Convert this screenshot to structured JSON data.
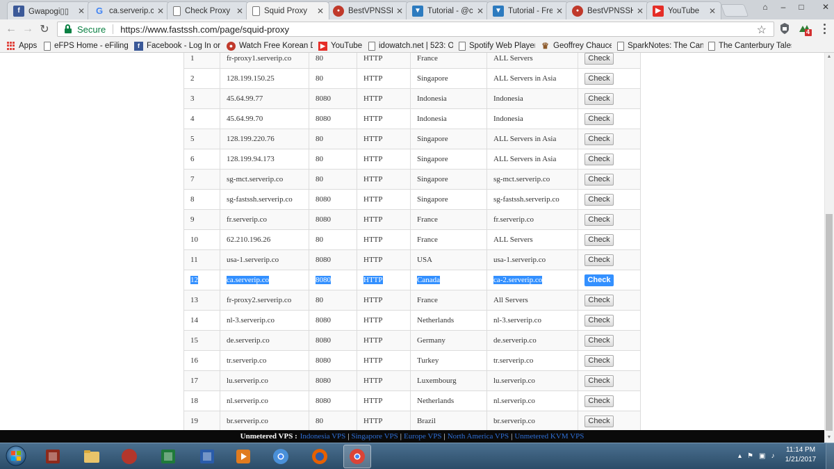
{
  "browser": {
    "tabs": [
      {
        "title": "Gwapogi▯▯",
        "favicon": "facebook-icon",
        "color": "#3b5998",
        "glyph": "f"
      },
      {
        "title": "ca.serverip.cc",
        "favicon": "google-icon",
        "color": "#4285f4",
        "glyph": "G"
      },
      {
        "title": "Check Proxy",
        "favicon": "page-icon",
        "color": "#ffffff",
        "glyph": ""
      },
      {
        "title": "Squid Proxy",
        "favicon": "page-icon",
        "color": "#ffffff",
        "glyph": ""
      },
      {
        "title": "BestVPNSSH",
        "favicon": "bestvpn-icon",
        "color": "#c0392b",
        "glyph": "●"
      },
      {
        "title": "Tutorial - @c",
        "favicon": "tutorial-icon",
        "color": "#2d7bbf",
        "glyph": "▼"
      },
      {
        "title": "Tutorial - Fre",
        "favicon": "tutorial-icon",
        "color": "#2d7bbf",
        "glyph": "▼"
      },
      {
        "title": "BestVPNSSH",
        "favicon": "bestvpn-icon",
        "color": "#c0392b",
        "glyph": "●"
      },
      {
        "title": "YouTube",
        "favicon": "youtube-icon",
        "color": "#e52d27",
        "glyph": "▶"
      }
    ],
    "active_tab": 3,
    "window_controls": {
      "user": "⌂",
      "minimize": "–",
      "maximize": "□",
      "close": "✕"
    },
    "nav": {
      "back": "←",
      "forward": "→",
      "reload": "↻"
    },
    "secure_label": "Secure",
    "url": "https://www.fastssh.com/page/squid-proxy",
    "extension_badge": "4"
  },
  "bookmarks": [
    {
      "label": "Apps",
      "icon": "apps-grid-icon"
    },
    {
      "label": "eFPS Home - eFiling a",
      "icon": "page-icon"
    },
    {
      "label": "Facebook - Log In or",
      "icon": "facebook-icon"
    },
    {
      "label": "Watch Free Korean Dr",
      "icon": "korean-drama-icon"
    },
    {
      "label": "YouTube",
      "icon": "youtube-icon"
    },
    {
      "label": "idowatch.net | 523: O",
      "icon": "page-icon"
    },
    {
      "label": "Spotify Web Player",
      "icon": "page-icon"
    },
    {
      "label": "Geoffrey Chaucer",
      "icon": "chaucer-icon"
    },
    {
      "label": "SparkNotes: The Cant",
      "icon": "page-icon"
    },
    {
      "label": "The Canterbury Tales",
      "icon": "page-icon"
    }
  ],
  "proxy_table": {
    "button_label": "Check",
    "selected_row": 12,
    "rows": [
      {
        "no": "1",
        "host": "fr-proxy1.serverip.co",
        "port": "80",
        "type": "HTTP",
        "country": "France",
        "server": "ALL Servers"
      },
      {
        "no": "2",
        "host": "128.199.150.25",
        "port": "80",
        "type": "HTTP",
        "country": "Singapore",
        "server": "ALL Servers in Asia"
      },
      {
        "no": "3",
        "host": "45.64.99.77",
        "port": "8080",
        "type": "HTTP",
        "country": "Indonesia",
        "server": "Indonesia"
      },
      {
        "no": "4",
        "host": "45.64.99.70",
        "port": "8080",
        "type": "HTTP",
        "country": "Indonesia",
        "server": "Indonesia"
      },
      {
        "no": "5",
        "host": "128.199.220.76",
        "port": "80",
        "type": "HTTP",
        "country": "Singapore",
        "server": "ALL Servers in Asia"
      },
      {
        "no": "6",
        "host": "128.199.94.173",
        "port": "80",
        "type": "HTTP",
        "country": "Singapore",
        "server": "ALL Servers in Asia"
      },
      {
        "no": "7",
        "host": "sg-mct.serverip.co",
        "port": "80",
        "type": "HTTP",
        "country": "Singapore",
        "server": "sg-mct.serverip.co"
      },
      {
        "no": "8",
        "host": "sg-fastssh.serverip.co",
        "port": "8080",
        "type": "HTTP",
        "country": "Singapore",
        "server": "sg-fastssh.serverip.co"
      },
      {
        "no": "9",
        "host": "fr.serverip.co",
        "port": "8080",
        "type": "HTTP",
        "country": "France",
        "server": "fr.serverip.co"
      },
      {
        "no": "10",
        "host": "62.210.196.26",
        "port": "80",
        "type": "HTTP",
        "country": "France",
        "server": "ALL Servers"
      },
      {
        "no": "11",
        "host": "usa-1.serverip.co",
        "port": "8080",
        "type": "HTTP",
        "country": "USA",
        "server": "usa-1.serverip.co"
      },
      {
        "no": "12",
        "host": "ca.serverip.co",
        "port": "8080",
        "type": "HTTP",
        "country": "Canada",
        "server": "ca-2.serverip.co"
      },
      {
        "no": "13",
        "host": "fr-proxy2.serverip.co",
        "port": "80",
        "type": "HTTP",
        "country": "France",
        "server": "All Servers"
      },
      {
        "no": "14",
        "host": "nl-3.serverip.co",
        "port": "8080",
        "type": "HTTP",
        "country": "Netherlands",
        "server": "nl-3.serverip.co"
      },
      {
        "no": "15",
        "host": "de.serverip.co",
        "port": "8080",
        "type": "HTTP",
        "country": "Germany",
        "server": "de.serverip.co"
      },
      {
        "no": "16",
        "host": "tr.serverip.co",
        "port": "8080",
        "type": "HTTP",
        "country": "Turkey",
        "server": "tr.serverip.co"
      },
      {
        "no": "17",
        "host": "lu.serverip.co",
        "port": "8080",
        "type": "HTTP",
        "country": "Luxembourg",
        "server": "lu.serverip.co"
      },
      {
        "no": "18",
        "host": "nl.serverip.co",
        "port": "8080",
        "type": "HTTP",
        "country": "Netherlands",
        "server": "nl.serverip.co"
      },
      {
        "no": "19",
        "host": "br.serverip.co",
        "port": "80",
        "type": "HTTP",
        "country": "Brazil",
        "server": "br.serverip.co"
      }
    ]
  },
  "footer_bar": {
    "label": "Unmetered VPS :",
    "links": [
      "Indonesia VPS",
      "Singapore VPS",
      "Europe VPS",
      "North America VPS",
      "Unmetered KVM VPS"
    ],
    "separator": "|"
  },
  "taskbar": {
    "apps": [
      {
        "name": "winrar-app",
        "icon": "winrar-icon",
        "color": "#8e2a1c"
      },
      {
        "name": "explorer-app",
        "icon": "folder-icon",
        "color": "#e9c46a"
      },
      {
        "name": "app-round-red",
        "icon": "red-orb-icon",
        "color": "#b3362b"
      },
      {
        "name": "excel-app",
        "icon": "excel-icon",
        "color": "#1f7a3a"
      },
      {
        "name": "word-app",
        "icon": "word-icon",
        "color": "#2a5caa"
      },
      {
        "name": "media-player-app",
        "icon": "media-player-icon",
        "color": "#e07b1f"
      },
      {
        "name": "chromium-app",
        "icon": "chromium-icon",
        "color": "#4a90d9"
      },
      {
        "name": "firefox-app",
        "icon": "firefox-icon",
        "color": "#e66000"
      },
      {
        "name": "chrome-app",
        "icon": "chrome-icon",
        "color": "#db4437"
      }
    ],
    "active_app": 8,
    "tray_icons": [
      "▴",
      "⚑",
      "▣",
      "♪"
    ],
    "time": "11:14 PM",
    "date": "1/21/2017"
  }
}
